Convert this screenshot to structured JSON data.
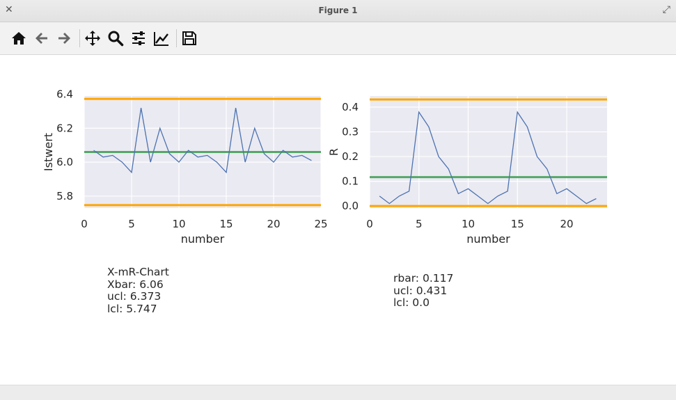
{
  "window": {
    "title": "Figure 1"
  },
  "toolbar": {
    "buttons": [
      {
        "name": "home-button",
        "icon": "home-icon"
      },
      {
        "name": "back-button",
        "icon": "arrow-left-icon"
      },
      {
        "name": "forward-button",
        "icon": "arrow-right-icon"
      },
      {
        "name": "pan-button",
        "icon": "move-icon"
      },
      {
        "name": "zoom-button",
        "icon": "magnifier-icon"
      },
      {
        "name": "configure-subplots-button",
        "icon": "sliders-icon"
      },
      {
        "name": "edit-axes-button",
        "icon": "line-chart-icon"
      },
      {
        "name": "save-button",
        "icon": "floppy-disk-icon"
      }
    ]
  },
  "colors": {
    "series": "#4c72b0",
    "limits": "#ffa500",
    "center": "#55a868",
    "axes_bg": "#eaeaf2",
    "grid": "#ffffff"
  },
  "chart_data": [
    {
      "type": "line",
      "xlabel": "number",
      "ylabel": "Istwert",
      "xlim": [
        0,
        25
      ],
      "ylim": [
        5.73,
        6.39
      ],
      "xticks": [
        0,
        5,
        10,
        15,
        20,
        25
      ],
      "yticks": [
        5.8,
        6.0,
        6.2,
        6.4
      ],
      "ytick_labels": [
        "5.8",
        "6.0",
        "6.2",
        "6.4"
      ],
      "grid": true,
      "series": [
        {
          "x": [
            1,
            2,
            3,
            4,
            5,
            6,
            7,
            8,
            9,
            10,
            11,
            12,
            13,
            14,
            15,
            16,
            17,
            18,
            19,
            20,
            21,
            22,
            23,
            24
          ],
          "values": [
            6.07,
            6.03,
            6.04,
            6.0,
            5.94,
            6.32,
            6.0,
            6.2,
            6.05,
            6.0,
            6.07,
            6.03,
            6.04,
            6.0,
            5.94,
            6.32,
            6.0,
            6.2,
            6.05,
            6.0,
            6.07,
            6.03,
            6.04,
            6.01
          ]
        }
      ],
      "hlines": [
        {
          "role": "ucl",
          "y": 6.373
        },
        {
          "role": "center",
          "y": 6.06
        },
        {
          "role": "lcl",
          "y": 5.747
        }
      ]
    },
    {
      "type": "line",
      "xlabel": "number",
      "ylabel": "R",
      "xlim": [
        0,
        24.1
      ],
      "ylim": [
        -0.008,
        0.445
      ],
      "xticks": [
        0,
        5,
        10,
        15,
        20
      ],
      "yticks": [
        0.0,
        0.1,
        0.2,
        0.3,
        0.4
      ],
      "ytick_labels": [
        "0.0",
        "0.1",
        "0.2",
        "0.3",
        "0.4"
      ],
      "grid": true,
      "series": [
        {
          "x": [
            1,
            2,
            3,
            4,
            5,
            6,
            7,
            8,
            9,
            10,
            11,
            12,
            13,
            14,
            15,
            16,
            17,
            18,
            19,
            20,
            21,
            22,
            23
          ],
          "values": [
            0.04,
            0.01,
            0.04,
            0.06,
            0.38,
            0.32,
            0.2,
            0.15,
            0.05,
            0.07,
            0.04,
            0.01,
            0.04,
            0.06,
            0.38,
            0.32,
            0.2,
            0.15,
            0.05,
            0.07,
            0.04,
            0.01,
            0.03
          ]
        }
      ],
      "hlines": [
        {
          "role": "ucl",
          "y": 0.431
        },
        {
          "role": "center",
          "y": 0.117
        },
        {
          "role": "lcl",
          "y": 0.0
        }
      ]
    }
  ],
  "stats_left": {
    "title": "X-mR-Chart",
    "xbar": "Xbar: 6.06",
    "ucl": "ucl: 6.373",
    "lcl": "lcl: 5.747"
  },
  "stats_right": {
    "rbar": "rbar: 0.117",
    "ucl": "ucl: 0.431",
    "lcl": "lcl: 0.0"
  }
}
